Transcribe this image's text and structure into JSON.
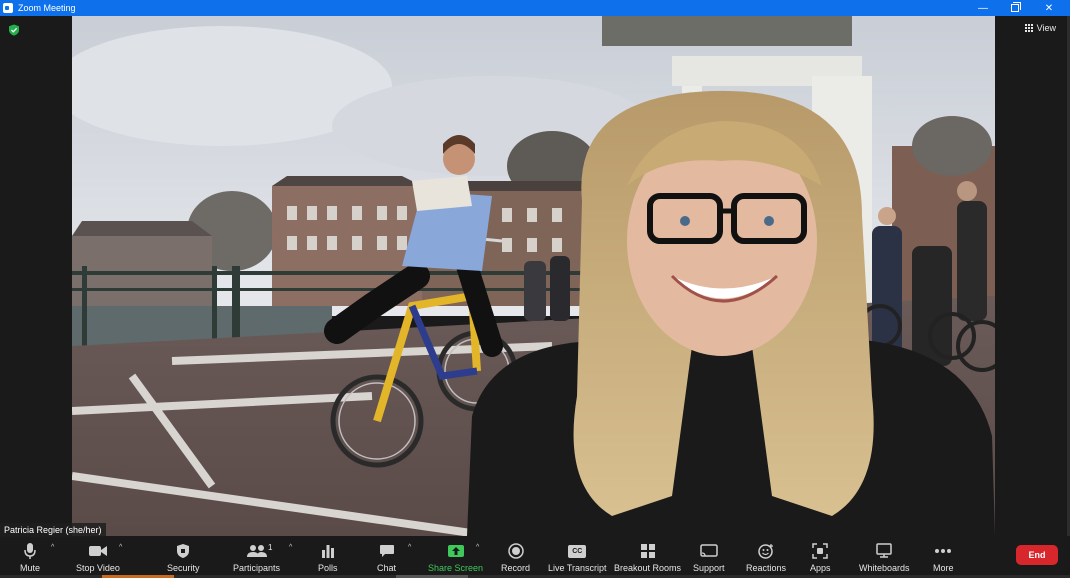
{
  "window": {
    "title": "Zoom Meeting"
  },
  "header": {
    "view_label": "View"
  },
  "video": {
    "participant_name": "Patricia Regier (she/her)"
  },
  "toolbar": {
    "mute": "Mute",
    "stop_video": "Stop Video",
    "security": "Security",
    "participants": "Participants",
    "participant_count": "1",
    "polls": "Polls",
    "chat": "Chat",
    "share_screen": "Share Screen",
    "record": "Record",
    "live_transcript": "Live Transcript",
    "cc_badge": "CC",
    "breakout_rooms": "Breakout Rooms",
    "support": "Support",
    "reactions": "Reactions",
    "apps": "Apps",
    "whiteboards": "Whiteboards",
    "more": "More",
    "end": "End"
  },
  "colors": {
    "titlebar": "#0e71eb",
    "end_button": "#d8262d",
    "share_screen": "#3ec95a"
  }
}
